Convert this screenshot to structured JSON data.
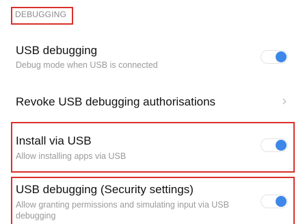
{
  "section": {
    "label": "DEBUGGING"
  },
  "rows": [
    {
      "title": "USB debugging",
      "subtitle": "Debug mode when USB is connected",
      "toggle_on": true
    },
    {
      "title": "Revoke USB debugging authorisations"
    },
    {
      "title": "Install via USB",
      "subtitle": "Allow installing apps via USB",
      "toggle_on": true
    },
    {
      "title": "USB debugging (Security settings)",
      "subtitle": "Allow granting permissions and simulating input via USB debugging",
      "toggle_on": true
    }
  ],
  "colors": {
    "accent": "#3d87e8",
    "highlight": "#d9302a"
  },
  "icons": {
    "chevron": "chevron-right-icon",
    "toggle": "toggle-switch-icon"
  }
}
